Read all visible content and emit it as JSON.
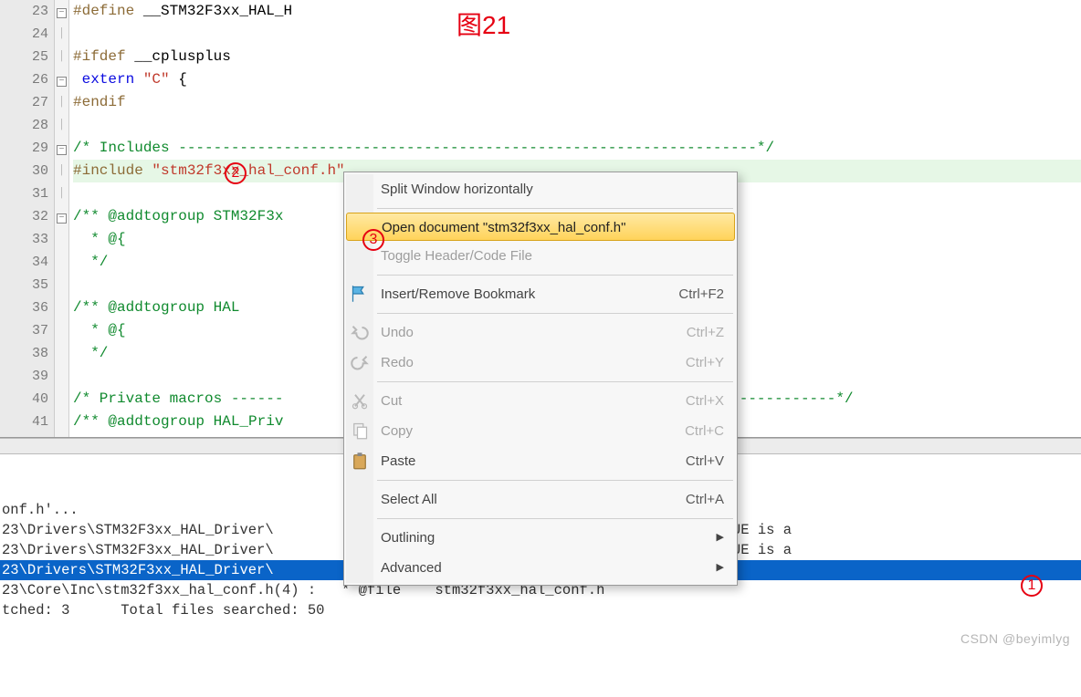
{
  "annotations": {
    "title": "图21",
    "circle2": "2",
    "circle3": "3",
    "circle1": "1"
  },
  "code": {
    "lines": [
      {
        "n": 23,
        "fold": "",
        "parts": [
          {
            "c": "tok-pre",
            "t": "#define "
          },
          {
            "c": "",
            "t": "__STM32F3xx_HAL_H"
          }
        ]
      },
      {
        "n": 24,
        "fold": "",
        "parts": []
      },
      {
        "n": 25,
        "fold": "box",
        "parts": [
          {
            "c": "tok-pre",
            "t": "#ifdef "
          },
          {
            "c": "",
            "t": "__cplusplus"
          }
        ]
      },
      {
        "n": 26,
        "fold": "line",
        "parts": [
          {
            "c": "",
            "t": " "
          },
          {
            "c": "tok-kw",
            "t": "extern"
          },
          {
            "c": "",
            "t": " "
          },
          {
            "c": "tok-str",
            "t": "\"C\""
          },
          {
            "c": "",
            "t": " {"
          }
        ]
      },
      {
        "n": 27,
        "fold": "line",
        "parts": [
          {
            "c": "tok-pre",
            "t": "#endif"
          }
        ]
      },
      {
        "n": 28,
        "fold": "",
        "parts": []
      },
      {
        "n": 29,
        "fold": "",
        "parts": [
          {
            "c": "tok-cm",
            "t": "/* Includes ------------------------------------------------------------------*/"
          }
        ]
      },
      {
        "n": 30,
        "fold": "",
        "hl": true,
        "parts": [
          {
            "c": "tok-pre",
            "t": "#include "
          },
          {
            "c": "tok-str",
            "t": "\"stm32f3xx_hal_conf.h\""
          }
        ]
      },
      {
        "n": 31,
        "fold": "",
        "parts": []
      },
      {
        "n": 32,
        "fold": "box",
        "parts": [
          {
            "c": "tok-cm",
            "t": "/** @addtogroup STM32F3x"
          }
        ]
      },
      {
        "n": 33,
        "fold": "line",
        "parts": [
          {
            "c": "tok-cm",
            "t": "  * @{"
          }
        ]
      },
      {
        "n": 34,
        "fold": "line",
        "parts": [
          {
            "c": "tok-cm",
            "t": "  */"
          }
        ]
      },
      {
        "n": 35,
        "fold": "",
        "parts": []
      },
      {
        "n": 36,
        "fold": "box",
        "parts": [
          {
            "c": "tok-cm",
            "t": "/** @addtogroup HAL"
          }
        ]
      },
      {
        "n": 37,
        "fold": "line",
        "parts": [
          {
            "c": "tok-cm",
            "t": "  * @{"
          }
        ]
      },
      {
        "n": 38,
        "fold": "line",
        "parts": [
          {
            "c": "tok-cm",
            "t": "  */"
          }
        ]
      },
      {
        "n": 39,
        "fold": "",
        "parts": []
      },
      {
        "n": 40,
        "fold": "",
        "parts": [
          {
            "c": "tok-cm",
            "t": "/* Private macros ------"
          },
          {
            "c": "tok-cm",
            "t": "                                       "
          },
          {
            "c": "tok-cm",
            "t": "------------------------*/"
          }
        ]
      },
      {
        "n": 41,
        "fold": "box",
        "parts": [
          {
            "c": "tok-cm",
            "t": "/** @addtogroup HAL_Priv"
          }
        ]
      }
    ]
  },
  "context_menu": {
    "items": [
      {
        "label": "Split Window horizontally",
        "shortcut": "",
        "icon": "none",
        "disabled": false,
        "highlight": false,
        "sep_after": true
      },
      {
        "label": "Open document \"stm32f3xx_hal_conf.h\"",
        "shortcut": "",
        "icon": "none",
        "disabled": false,
        "highlight": true,
        "sep_after": false
      },
      {
        "label": "Toggle Header/Code File",
        "shortcut": "",
        "icon": "none",
        "disabled": true,
        "highlight": false,
        "sep_after": true
      },
      {
        "label": "Insert/Remove Bookmark",
        "shortcut": "Ctrl+F2",
        "icon": "flag",
        "disabled": false,
        "highlight": false,
        "sep_after": true
      },
      {
        "label": "Undo",
        "shortcut": "Ctrl+Z",
        "icon": "undo",
        "disabled": true,
        "highlight": false,
        "sep_after": false
      },
      {
        "label": "Redo",
        "shortcut": "Ctrl+Y",
        "icon": "redo",
        "disabled": true,
        "highlight": false,
        "sep_after": true
      },
      {
        "label": "Cut",
        "shortcut": "Ctrl+X",
        "icon": "cut",
        "disabled": true,
        "highlight": false,
        "sep_after": false
      },
      {
        "label": "Copy",
        "shortcut": "Ctrl+C",
        "icon": "copy",
        "disabled": true,
        "highlight": false,
        "sep_after": false
      },
      {
        "label": "Paste",
        "shortcut": "Ctrl+V",
        "icon": "paste",
        "disabled": false,
        "highlight": false,
        "sep_after": true
      },
      {
        "label": "Select All",
        "shortcut": "Ctrl+A",
        "icon": "none",
        "disabled": false,
        "highlight": false,
        "sep_after": true
      },
      {
        "label": "Outlining",
        "shortcut": "",
        "icon": "none",
        "disabled": false,
        "highlight": false,
        "submenu": true,
        "sep_after": false
      },
      {
        "label": "Advanced",
        "shortcut": "",
        "icon": "none",
        "disabled": false,
        "highlight": false,
        "submenu": true,
        "sep_after": false
      }
    ]
  },
  "output": {
    "lines": [
      {
        "text": "onf.h'...",
        "selected": false
      },
      {
        "text": "23\\Drivers\\STM32F3xx_HAL_Driver\\                               @note      (*)  HSI_VALUE is a",
        "selected": false
      },
      {
        "text": "23\\Drivers\\STM32F3xx_HAL_Driver\\                               @note      (**) HSE_VALUE is a",
        "selected": false
      },
      {
        "text": "23\\Drivers\\STM32F3xx_HAL_Driver\\                               \"stm32f3xx_hal_conf.h\"",
        "selected": true
      },
      {
        "text": "23\\Core\\Inc\\stm32f3xx_hal_conf.h(4) :   * @file    stm32f3xx_hal_conf.h",
        "selected": false
      },
      {
        "text": "tched: 3      Total files searched: 50",
        "selected": false
      }
    ]
  },
  "watermark": "CSDN @beyimlyg"
}
